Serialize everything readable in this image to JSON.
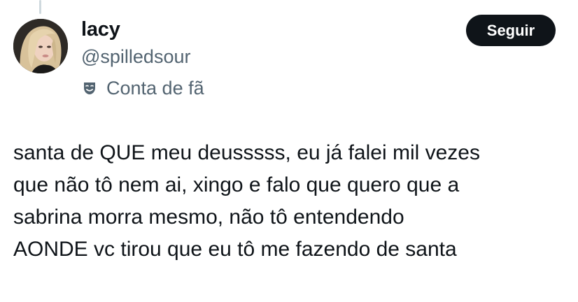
{
  "author": {
    "display_name": "lacy",
    "handle": "@spilledsour",
    "badge_icon": "theater-masks-icon",
    "badge_label": "Conta de fã"
  },
  "actions": {
    "follow_label": "Seguir"
  },
  "tweet": {
    "lines": [
      "santa de QUE meu deusssss, eu já falei mil vezes",
      "que não tô nem ai, xingo e falo que quero que a",
      "sabrina morra mesmo, não tô entendendo",
      "AONDE vc tirou que eu tô me fazendo de santa"
    ]
  },
  "colors": {
    "text_primary": "#0f1419",
    "text_secondary": "#536471",
    "button_bg": "#0f1419",
    "button_text": "#ffffff",
    "background": "#ffffff"
  }
}
